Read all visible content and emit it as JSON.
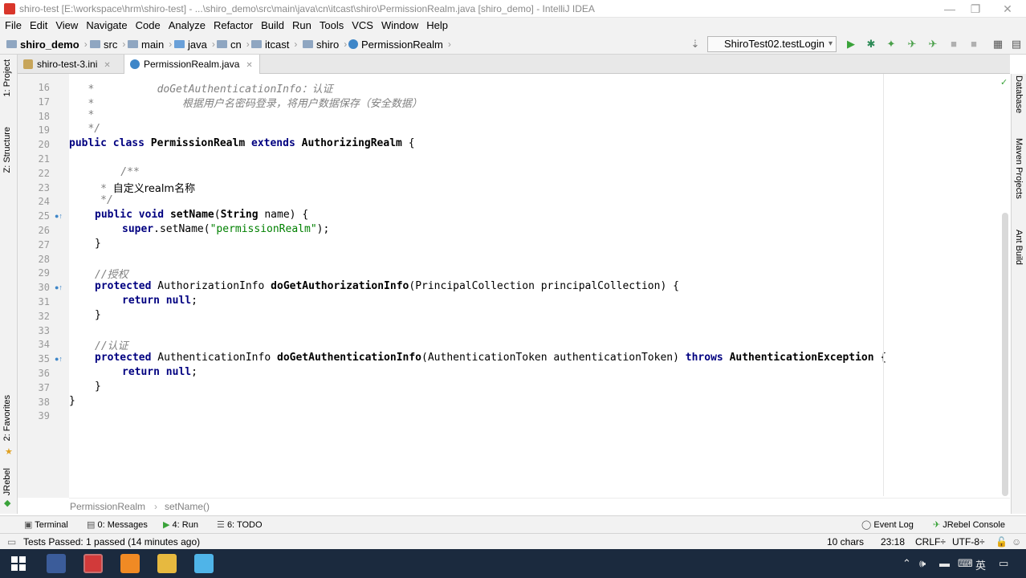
{
  "window": {
    "title": "shiro-test [E:\\workspace\\hrm\\shiro-test] - ...\\shiro_demo\\src\\main\\java\\cn\\itcast\\shiro\\PermissionRealm.java [shiro_demo] - IntelliJ IDEA",
    "min_glyph": "—",
    "max_glyph": "❐",
    "close_glyph": "✕"
  },
  "menu": [
    "File",
    "Edit",
    "View",
    "Navigate",
    "Code",
    "Analyze",
    "Refactor",
    "Build",
    "Run",
    "Tools",
    "VCS",
    "Window",
    "Help"
  ],
  "nav": {
    "items": [
      "shiro_demo",
      "src",
      "main",
      "java",
      "cn",
      "itcast",
      "shiro",
      "PermissionRealm"
    ],
    "run_config": "ShiroTest02.testLogin"
  },
  "tabs": [
    {
      "label": "shiro-test-3.ini",
      "active": false
    },
    {
      "label": "PermissionRealm.java",
      "active": true
    }
  ],
  "left_tools": [
    "1: Project",
    "Z: Structure",
    "2: Favorites",
    "JRebel"
  ],
  "right_tools": [
    "Database",
    "Maven Projects",
    "Ant Build"
  ],
  "code": {
    "line_numbers": [
      "16",
      "17",
      "18",
      "19",
      "20",
      "21",
      "22",
      "23",
      "24",
      "25",
      "26",
      "27",
      "28",
      "29",
      "30",
      "31",
      "32",
      "33",
      "34",
      "35",
      "36",
      "37",
      "38",
      "39"
    ],
    "l16a": "   *          ",
    "l16b": "doGetAuthenticationInfo：认证",
    "l17a": "   *              ",
    "l17b": "根据用户名密码登录，将用户数据保存（安全数据）",
    "l18": "   *",
    "l19": "   */",
    "l20_public": "public",
    "l20_class": "class",
    "l20_name": "PermissionRealm",
    "l20_extends": "extends",
    "l20_parent": "AuthorizingRealm",
    "l20_brace": "{",
    "l22": "    /**",
    "l23_star": "     * ",
    "l23_text": "自定义realm名称",
    "l24": "     */",
    "l25_public": "public",
    "l25_void": "void",
    "l25_name": "setName",
    "l25_type": "String",
    "l25_arg": "name",
    "l26_super": "super",
    "l26_call": ".setName(",
    "l26_str": "\"permissionRealm\"",
    "l26_end": ");",
    "l27": "}",
    "l29": "//授权",
    "l30_prot": "protected",
    "l30_type": "AuthorizationInfo",
    "l30_name": "doGetAuthorizationInfo",
    "l30_ptype": "PrincipalCollection",
    "l30_arg": "principalCollection",
    "l31_return": "return",
    "l31_null": "null",
    "l32": "}",
    "l34": "//认证",
    "l35_prot": "protected",
    "l35_type": "AuthenticationInfo",
    "l35_name": "doGetAuthenticationInfo",
    "l35_ptype": "AuthenticationToken",
    "l35_arg": "authenticationToken",
    "l35_throws": "throws",
    "l35_ex": "AuthenticationException",
    "l36_return": "return",
    "l36_null": "null",
    "l37": "}",
    "l38": "}"
  },
  "breadcrumb": [
    "PermissionRealm",
    "setName()"
  ],
  "tool_windows": {
    "terminal": "Terminal",
    "messages": "0: Messages",
    "run": "4: Run",
    "todo": "6: TODO",
    "event_log": "Event Log",
    "jrebel_console": "JRebel Console"
  },
  "status": {
    "message": "Tests Passed: 1 passed (14 minutes ago)",
    "chars": "10 chars",
    "position": "23:18",
    "line_sep": "CRLF",
    "encoding": "UTF-8"
  },
  "taskbar": {
    "ime": "英"
  }
}
